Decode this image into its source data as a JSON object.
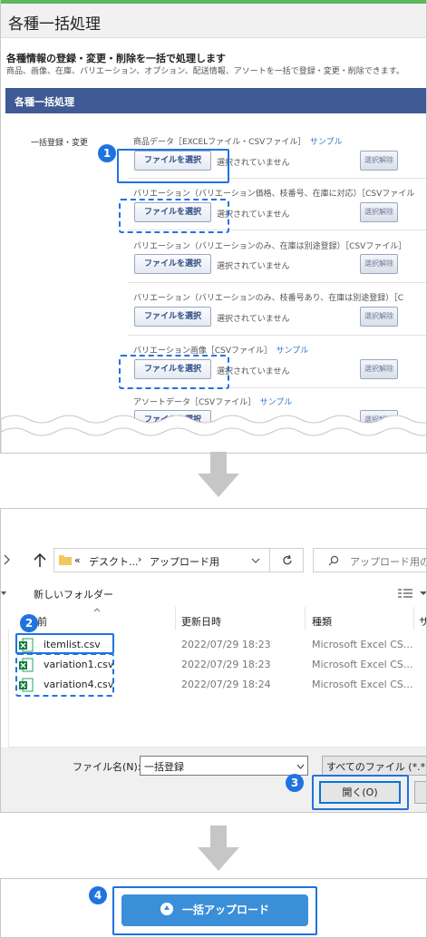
{
  "panel1": {
    "header_title": "各種一括処理",
    "subtitle": "各種情報の登録・変更・削除を一括で処理します",
    "description": "商品、画像、在庫、バリエーション、オプション、配送情報、アソートを一括で登録・変更・削除できます。",
    "section_bar": "各種一括処理",
    "section_label": "一括登録・変更",
    "file_button": "ファイルを選択",
    "no_file": "選択されていません",
    "clear_button": "選択解除",
    "rows": [
      {
        "label": "商品データ［EXCELファイル・CSVファイル］",
        "sample": "サンプル"
      },
      {
        "label": "バリエーション（バリエーション価格、枝番号、在庫に対応）［CSVファイル",
        "sample": ""
      },
      {
        "label": "バリエーション（バリエーションのみ、在庫は別途登録）［CSVファイル］",
        "sample": ""
      },
      {
        "label": "バリエーション（バリエーションのみ、枝番号あり、在庫は別途登録）［C",
        "sample": ""
      },
      {
        "label": "バリエーション画像［CSVファイル］",
        "sample": "サンプル"
      },
      {
        "label": "アソートデータ［CSVファイル］",
        "sample": "サンプル"
      }
    ]
  },
  "steps": [
    "1",
    "2",
    "3",
    "4"
  ],
  "dialog": {
    "breadcrumb_prefix": "«",
    "breadcrumb_parent": "デスクト...",
    "breadcrumb_sep": "›",
    "breadcrumb_current": "アップロード用",
    "search_placeholder": "アップロード用の検",
    "new_folder": "新しいフォルダー",
    "col_name": "前",
    "col_date": "更新日時",
    "col_type": "種類",
    "col_size": "サ",
    "files": [
      {
        "name": "itemlist.csv",
        "date": "2022/07/29 18:23",
        "type": "Microsoft Excel CS..."
      },
      {
        "name": "variation1.csv",
        "date": "2022/07/29 18:23",
        "type": "Microsoft Excel CS..."
      },
      {
        "name": "variation4.csv",
        "date": "2022/07/29 18:24",
        "type": "Microsoft Excel CS..."
      }
    ],
    "filename_label": "ファイル名(N):",
    "filename_value": "一括登録",
    "filetype_value": "すべてのファイル (*.*)",
    "open_button": "開く(O)"
  },
  "upload": {
    "button": "一括アップロード"
  },
  "colors": {
    "accent": "#1f73e0",
    "header_bar": "#3f5a94",
    "upload": "#3b8fd9",
    "green_rule": "#5cb85c"
  }
}
